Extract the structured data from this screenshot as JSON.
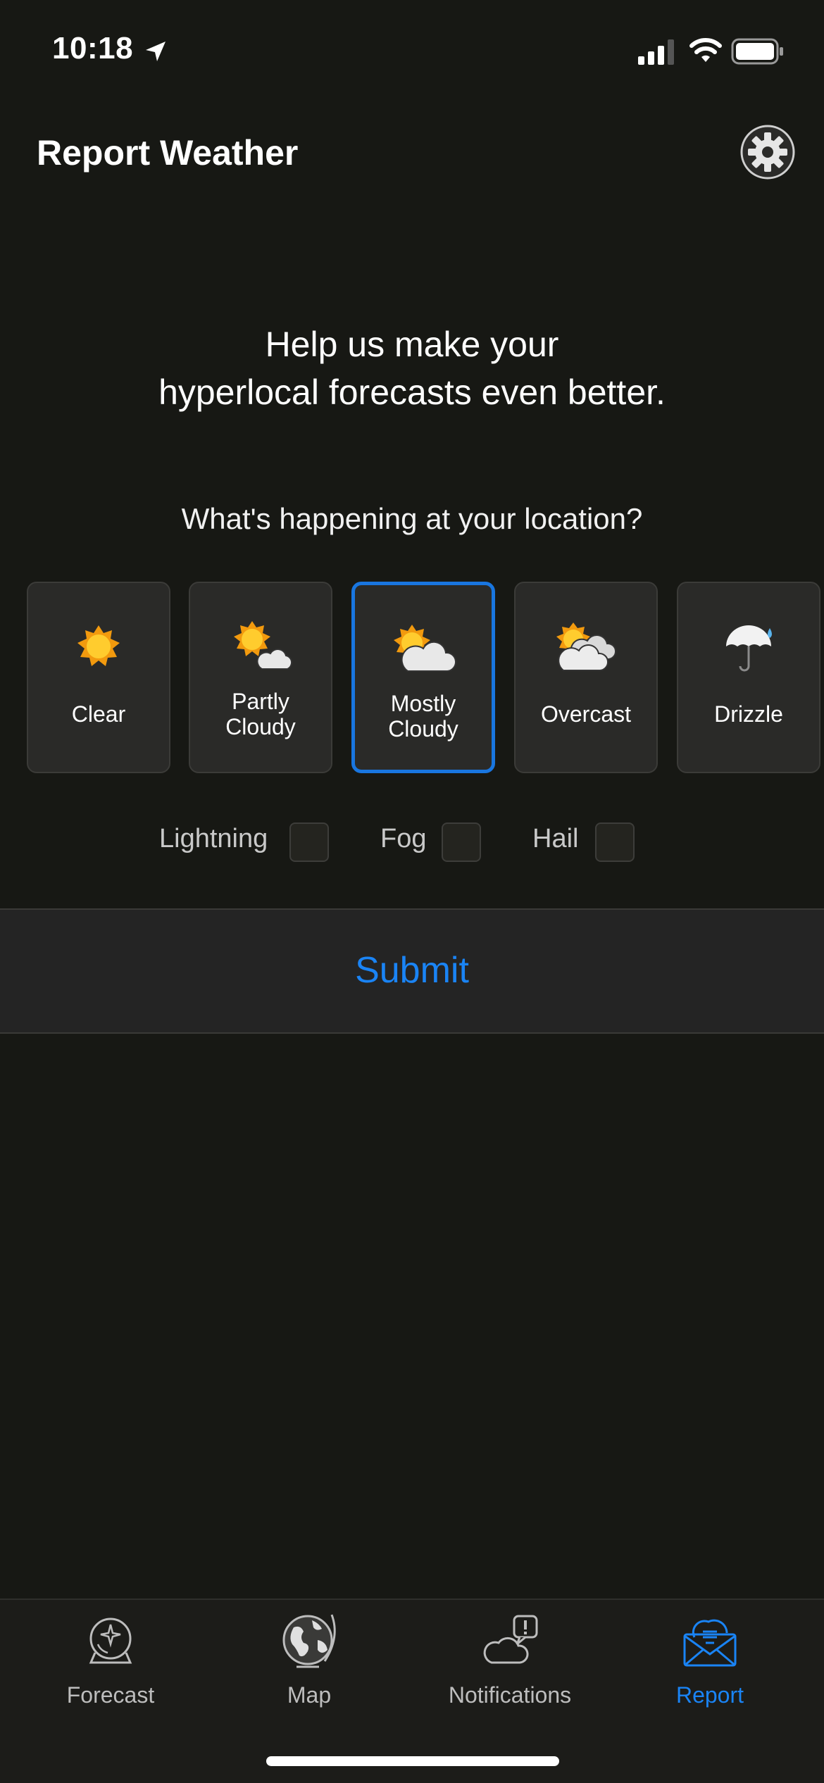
{
  "status_bar": {
    "time": "10:18"
  },
  "header": {
    "title": "Report Weather"
  },
  "intro": {
    "line1": "Help us make your",
    "line2": "hyperlocal forecasts even better."
  },
  "prompt": "What's happening at your location?",
  "conditions": [
    {
      "label": "Clear",
      "icon": "sun-icon",
      "selected": false
    },
    {
      "label": "Partly\nCloudy",
      "icon": "partly-cloudy-icon",
      "selected": false
    },
    {
      "label": "Mostly\nCloudy",
      "icon": "mostly-cloudy-icon",
      "selected": true
    },
    {
      "label": "Overcast",
      "icon": "overcast-icon",
      "selected": false
    },
    {
      "label": "Drizzle",
      "icon": "drizzle-umbrella-icon",
      "selected": false
    }
  ],
  "extras": [
    {
      "label": "Lightning",
      "checked": false
    },
    {
      "label": "Fog",
      "checked": false
    },
    {
      "label": "Hail",
      "checked": false
    }
  ],
  "submit_label": "Submit",
  "tabs": [
    {
      "label": "Forecast",
      "icon": "crystal-ball-icon",
      "active": false
    },
    {
      "label": "Map",
      "icon": "globe-icon",
      "active": false
    },
    {
      "label": "Notifications",
      "icon": "cloud-alert-icon",
      "active": false
    },
    {
      "label": "Report",
      "icon": "mail-cloud-icon",
      "active": true
    }
  ],
  "colors": {
    "accent": "#1a84f5",
    "selected_border": "#1976e0",
    "background": "#171814",
    "card": "#2a2a28"
  }
}
